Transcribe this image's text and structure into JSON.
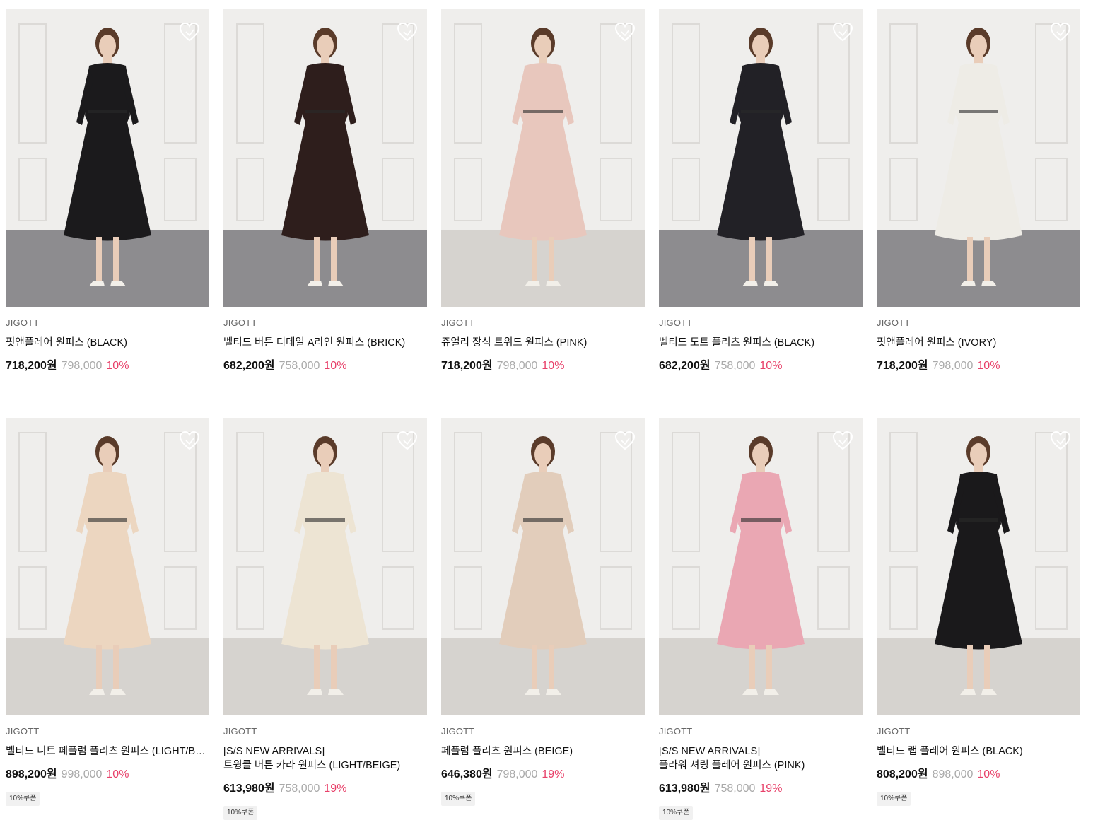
{
  "products": [
    {
      "brand": "JIGOTT",
      "name": "핏앤플레어 원피스 (BLACK)",
      "price": "718,200원",
      "original": "798,000",
      "discount": "10%",
      "coupon": "",
      "dress_color": "#1b1a1c",
      "floor": "dark"
    },
    {
      "brand": "JIGOTT",
      "name": "벨티드 버튼 디테일 A라인 원피스 (BRICK)",
      "price": "682,200원",
      "original": "758,000",
      "discount": "10%",
      "coupon": "",
      "dress_color": "#2e1e1c",
      "floor": "dark"
    },
    {
      "brand": "JIGOTT",
      "name": "쥬얼리 장식 트위드 원피스 (PINK)",
      "price": "718,200원",
      "original": "798,000",
      "discount": "10%",
      "coupon": "",
      "dress_color": "#e8c7bd",
      "floor": "light"
    },
    {
      "brand": "JIGOTT",
      "name": "벨티드 도트 플리츠 원피스 (BLACK)",
      "price": "682,200원",
      "original": "758,000",
      "discount": "10%",
      "coupon": "",
      "dress_color": "#222126",
      "floor": "dark"
    },
    {
      "brand": "JIGOTT",
      "name": "핏앤플레어 원피스 (IVORY)",
      "price": "718,200원",
      "original": "798,000",
      "discount": "10%",
      "coupon": "",
      "dress_color": "#eeece6",
      "floor": "dark"
    },
    {
      "brand": "JIGOTT",
      "name": "벨티드 니트 페플럼 플리츠 원피스 (LIGHT/BEIGE)",
      "price": "898,200원",
      "original": "998,000",
      "discount": "10%",
      "coupon": "10%쿠폰",
      "dress_color": "#ecd6c0",
      "floor": "light"
    },
    {
      "brand": "JIGOTT",
      "name": "[S/S NEW ARRIVALS]",
      "name2": "트윙클 버튼 카라 원피스 (LIGHT/BEIGE)",
      "price": "613,980원",
      "original": "758,000",
      "discount": "19%",
      "coupon": "10%쿠폰",
      "dress_color": "#ede4d3",
      "floor": "light"
    },
    {
      "brand": "JIGOTT",
      "name": "페플럼 플리츠 원피스 (BEIGE)",
      "price": "646,380원",
      "original": "798,000",
      "discount": "19%",
      "coupon": "10%쿠폰",
      "dress_color": "#e2cdbb",
      "floor": "light"
    },
    {
      "brand": "JIGOTT",
      "name": "[S/S NEW ARRIVALS]",
      "name2": "플라워 셔링 플레어 원피스 (PINK)",
      "price": "613,980원",
      "original": "758,000",
      "discount": "19%",
      "coupon": "10%쿠폰",
      "dress_color": "#eaa7b3",
      "floor": "light"
    },
    {
      "brand": "JIGOTT",
      "name": "벨티드 랩 플레어 원피스 (BLACK)",
      "price": "808,200원",
      "original": "898,000",
      "discount": "10%",
      "coupon": "10%쿠폰",
      "dress_color": "#1a191b",
      "floor": "light"
    }
  ],
  "icons": {
    "wishlist": "heart-outline-icon"
  }
}
